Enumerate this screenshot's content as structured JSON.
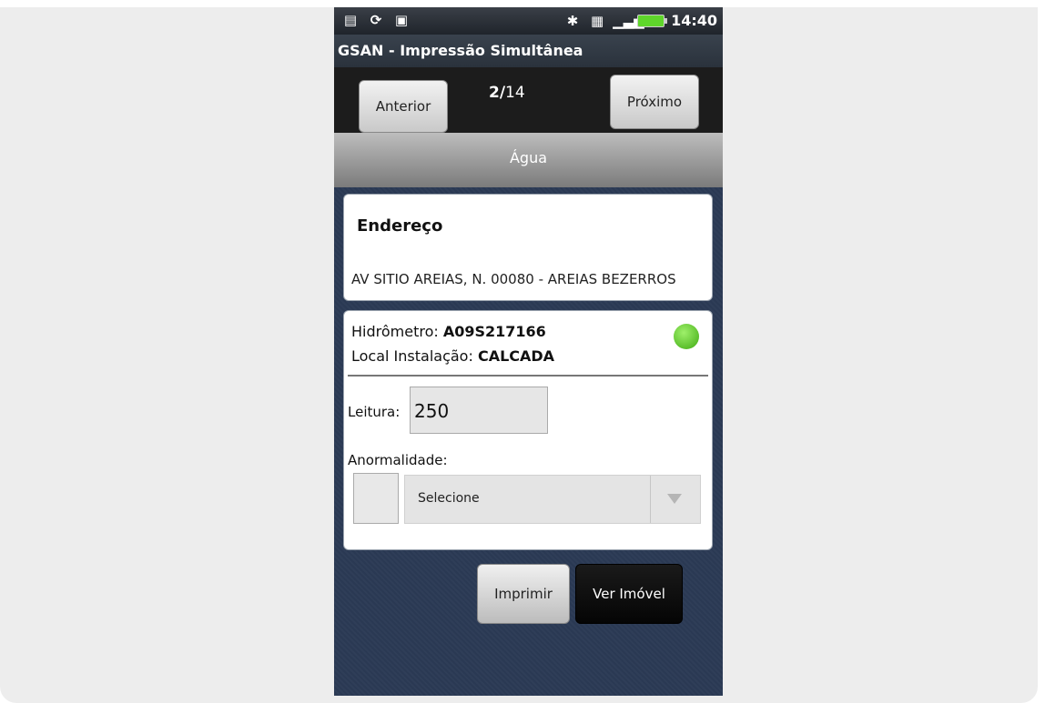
{
  "status_bar": {
    "time": "14:40",
    "icons": [
      "notification-icon",
      "sync-icon",
      "usb-icon",
      "bluetooth-icon",
      "sd-card-icon",
      "signal-icon",
      "battery-icon"
    ],
    "battery_color": "#5fd62b"
  },
  "app": {
    "title": "GSAN - Impressão Simultânea"
  },
  "nav": {
    "prev_label": "Anterior",
    "next_label": "Próximo",
    "current": "2/",
    "total": "14"
  },
  "section": {
    "title": "Água"
  },
  "address": {
    "title": "Endereço",
    "value": "AV SITIO AREIAS, N. 00080 - AREIAS BEZERROS"
  },
  "meter": {
    "hidro_label": "Hidrômetro: ",
    "hidro_value": "A09S217166",
    "local_label": "Local Instalação: ",
    "local_value": "CALCADA",
    "status_color": "#3faa12"
  },
  "reading": {
    "label": "Leitura:",
    "value": "250"
  },
  "anomaly": {
    "label": "Anormalidade:",
    "selected": "Selecione"
  },
  "actions": {
    "print_label": "Imprimir",
    "view_label": "Ver Imóvel"
  }
}
